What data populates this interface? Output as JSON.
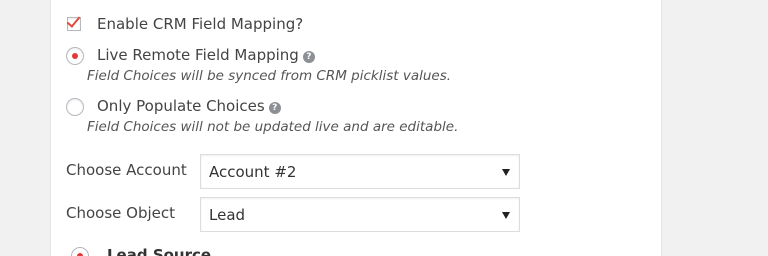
{
  "crm_mapping": {
    "enable_label": "Enable CRM Field Mapping?",
    "enable_checked": true,
    "options": [
      {
        "label": "Live Remote Field Mapping",
        "description": "Field Choices will be synced from CRM picklist values.",
        "selected": true,
        "help_icon": "question-circle-icon"
      },
      {
        "label": "Only Populate Choices",
        "description": "Field Choices will not be updated live and are editable.",
        "selected": false,
        "help_icon": "question-circle-icon"
      }
    ]
  },
  "account": {
    "label": "Choose Account",
    "value": "Account #2"
  },
  "object": {
    "label": "Choose Object",
    "value": "Lead"
  },
  "partial": {
    "label": "Lead Source"
  },
  "colors": {
    "accent": "#dd4a3f",
    "radio_dot": "#e53935",
    "background": "#f1f1f1",
    "panel": "#ffffff"
  }
}
